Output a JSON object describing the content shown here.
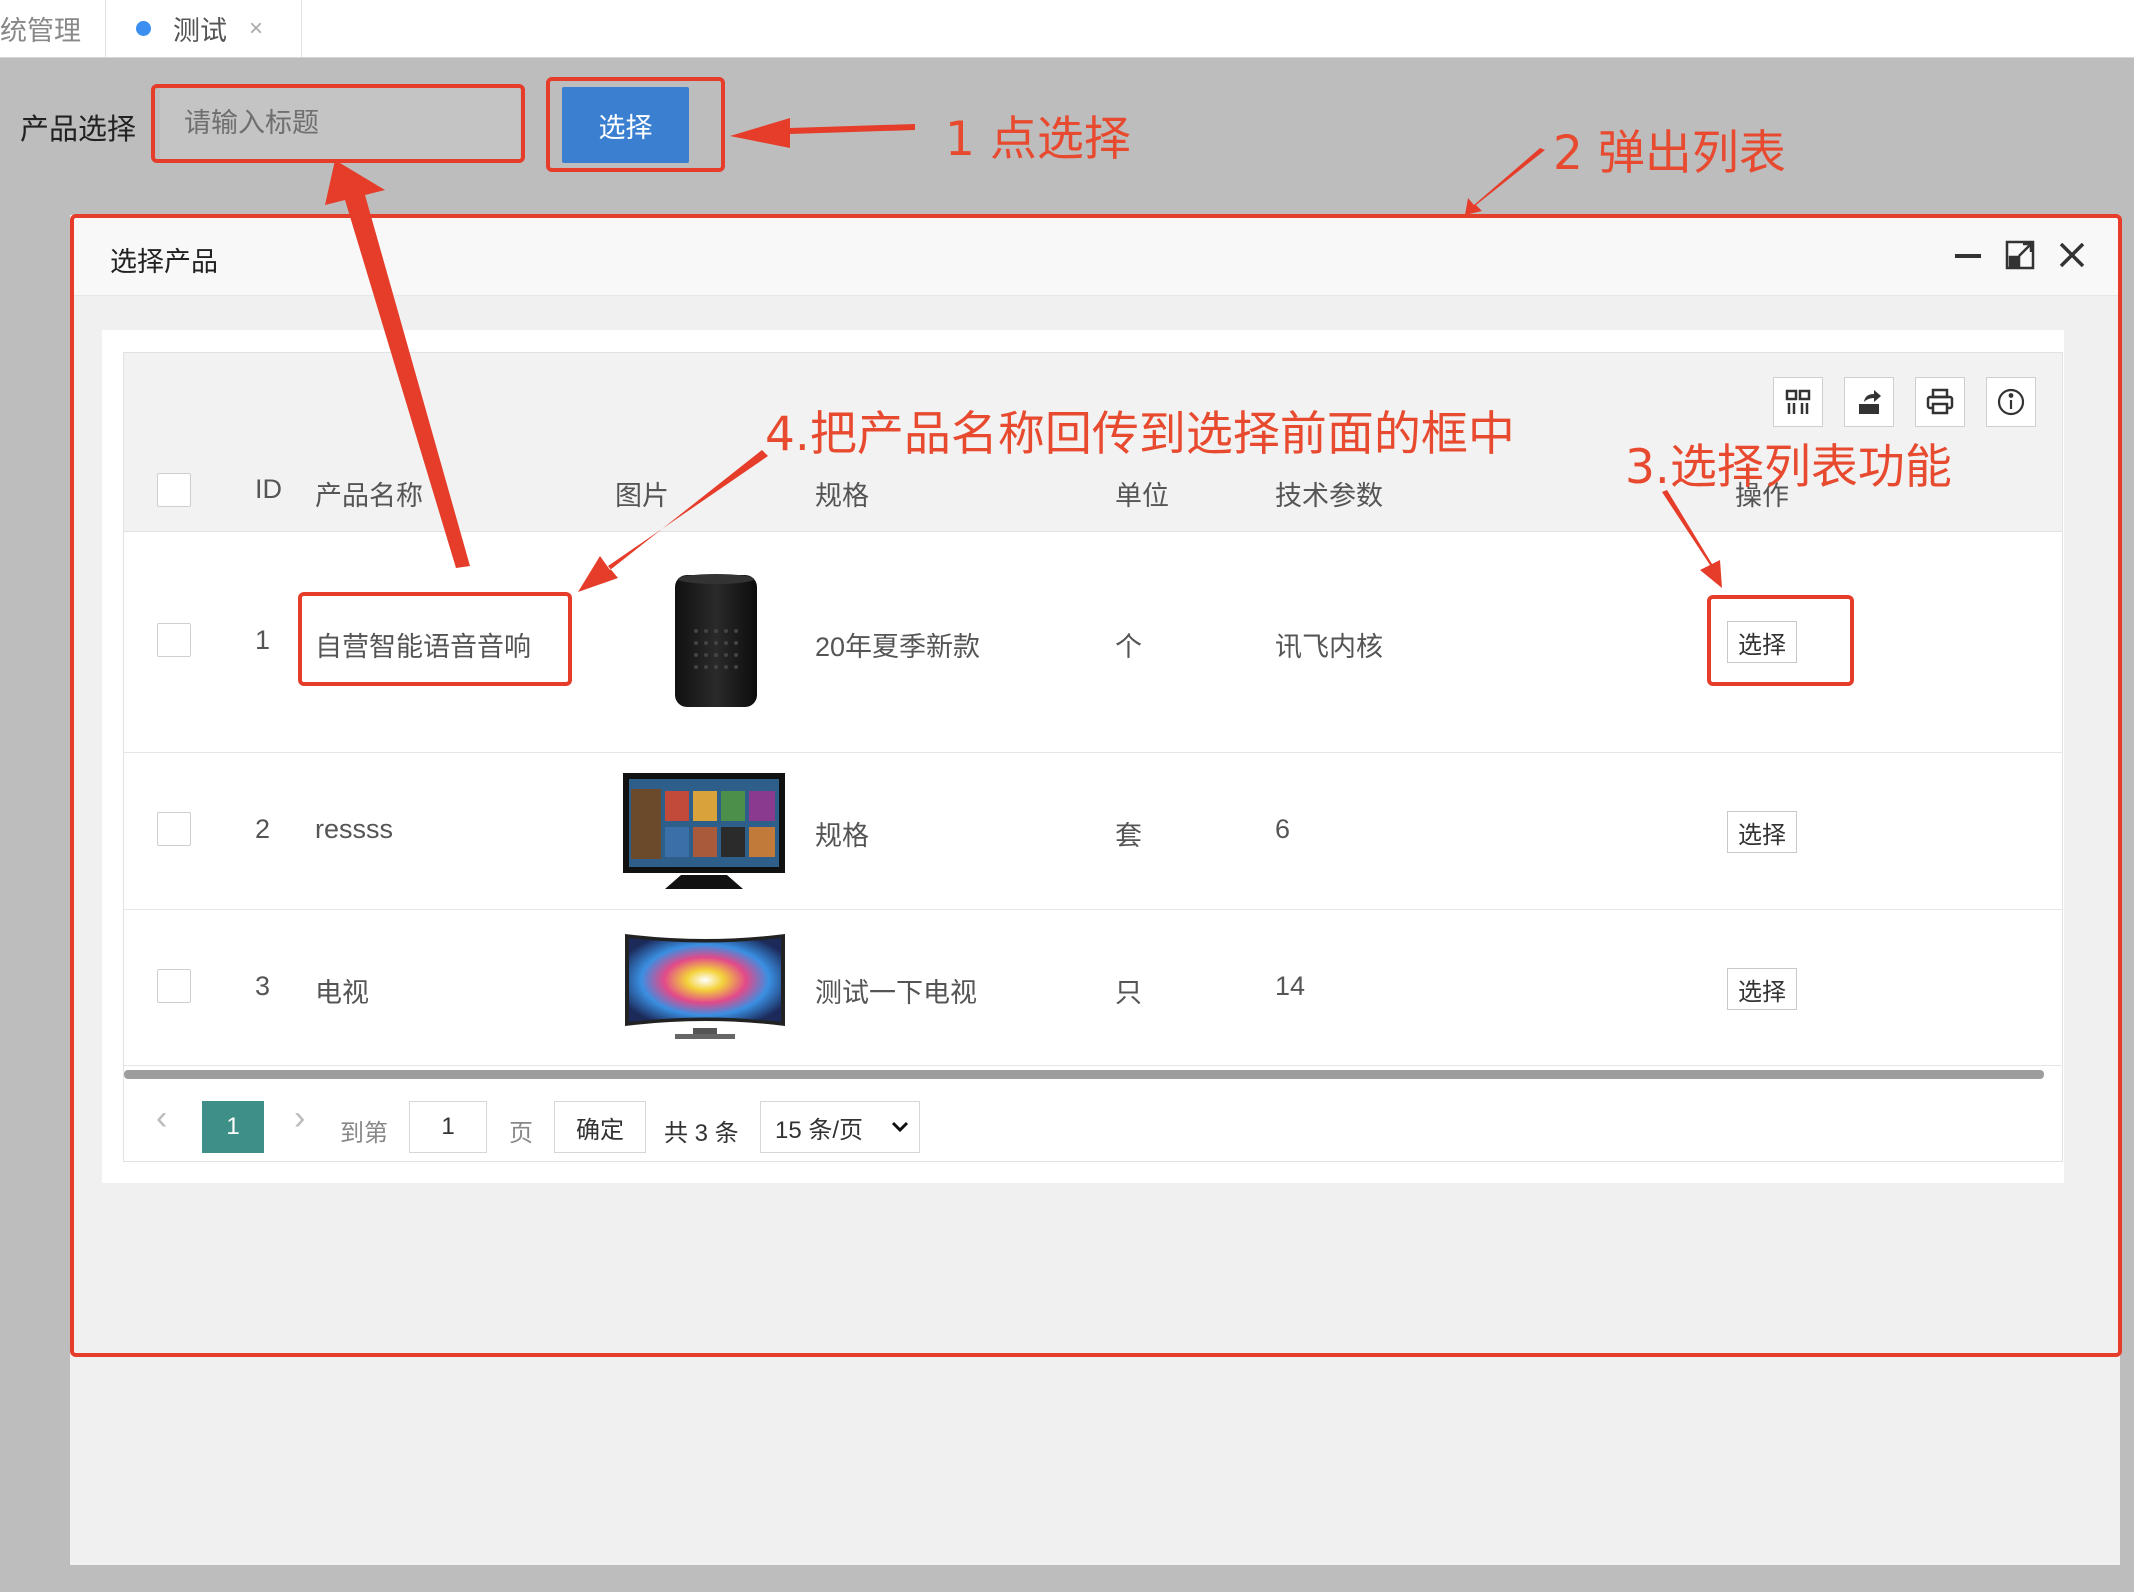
{
  "tabs": [
    {
      "label": "统管理"
    },
    {
      "label": "测试",
      "close": "×"
    }
  ],
  "form": {
    "label": "产品选择",
    "input_placeholder": "请输入标题",
    "choose_button": "选择"
  },
  "dialog": {
    "title": "选择产品",
    "controls": {
      "minimize": "—",
      "maximize": "⤢",
      "close": "✕"
    },
    "toolbar_icons": [
      "columns-icon",
      "export-icon",
      "print-icon",
      "info-icon"
    ],
    "columns": [
      "ID",
      "产品名称",
      "图片",
      "规格",
      "单位",
      "技术参数",
      "操作"
    ],
    "rows": [
      {
        "id": "1",
        "name": "自营智能语音音响",
        "image": "smart-speaker",
        "spec": "20年夏季新款",
        "unit": "个",
        "params": "讯飞内核",
        "action": "选择"
      },
      {
        "id": "2",
        "name": "ressss",
        "image": "tv-screen",
        "spec": "规格",
        "unit": "套",
        "params": "6",
        "action": "选择"
      },
      {
        "id": "3",
        "name": "电视",
        "image": "curved-tv",
        "spec": "测试一下电视",
        "unit": "只",
        "params": "14",
        "action": "选择"
      }
    ],
    "pager": {
      "prev": "‹",
      "current_page": "1",
      "next": "›",
      "goto_prefix": "到第",
      "goto_value": "1",
      "goto_suffix": "页",
      "confirm": "确定",
      "total": "共 3 条",
      "page_size": "15 条/页"
    }
  },
  "annotations": {
    "step1": "1 点选择",
    "step2": "2 弹出列表",
    "step3": "3.选择列表功能",
    "step4": "4.把产品名称回传到选择前面的框中"
  },
  "colors": {
    "annotation_red": "#e84a2f",
    "primary_blue": "#3a7fd0",
    "pager_active": "#3e8f87"
  }
}
